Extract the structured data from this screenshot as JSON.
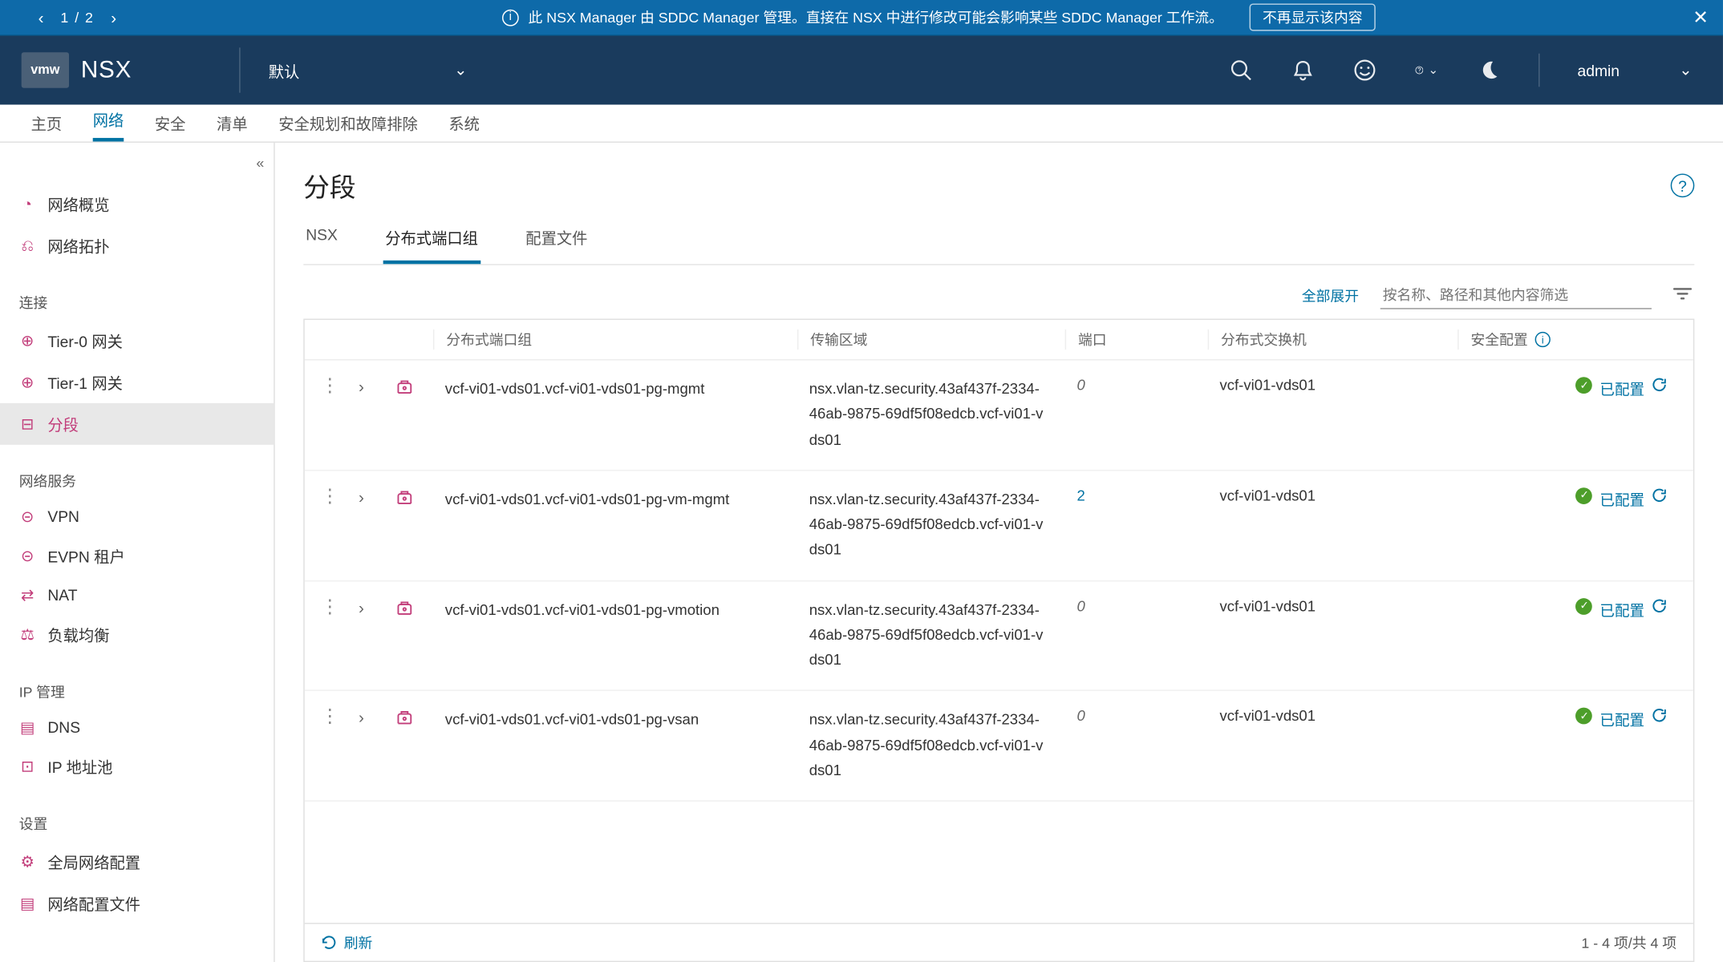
{
  "banner": {
    "pager": "1 / 2",
    "info_glyph": "i",
    "message": "此 NSX Manager 由 SDDC Manager 管理。直接在 NSX 中进行修改可能会影响某些 SDDC Manager 工作流。",
    "dismiss": "不再显示该内容",
    "close_glyph": "✕"
  },
  "header": {
    "logo": "vmw",
    "brand": "NSX",
    "tenant": "默认",
    "user": "admin",
    "chevron_glyph": "⌄",
    "icons": {
      "search": "⌕",
      "bell": "🔔",
      "smiley": "☺",
      "help": "?",
      "dark": "☾"
    }
  },
  "top_tabs": [
    "主页",
    "网络",
    "安全",
    "清单",
    "安全规划和故障排除",
    "系统"
  ],
  "top_tabs_active": 1,
  "sidebar": {
    "collapse_glyph": "«",
    "groups": [
      {
        "label": "",
        "items": [
          {
            "icon": "◔",
            "label": "网络概览",
            "pink": true
          },
          {
            "icon": "⎌",
            "label": "网络拓扑",
            "pink": true
          }
        ]
      },
      {
        "label": "连接",
        "items": [
          {
            "icon": "⊕",
            "label": "Tier-0 网关",
            "pink": true
          },
          {
            "icon": "⊕",
            "label": "Tier-1 网关",
            "pink": true
          },
          {
            "icon": "⊟",
            "label": "分段",
            "pink": true,
            "active": true
          }
        ]
      },
      {
        "label": "网络服务",
        "items": [
          {
            "icon": "⊝",
            "label": "VPN",
            "pink": true
          },
          {
            "icon": "⊝",
            "label": "EVPN 租户",
            "pink": true
          },
          {
            "icon": "⇄",
            "label": "NAT",
            "pink": true
          },
          {
            "icon": "⚖",
            "label": "负载均衡",
            "pink": true
          }
        ]
      },
      {
        "label": "IP 管理",
        "items": [
          {
            "icon": "▤",
            "label": "DNS",
            "pink": true
          },
          {
            "icon": "⊡",
            "label": "IP 地址池",
            "pink": true
          }
        ]
      },
      {
        "label": "设置",
        "items": [
          {
            "icon": "⚙",
            "label": "全局网络配置",
            "pink": true
          },
          {
            "icon": "▤",
            "label": "网络配置文件",
            "pink": true
          }
        ]
      }
    ]
  },
  "page": {
    "title": "分段",
    "help": "?",
    "subtabs": [
      "NSX",
      "分布式端口组",
      "配置文件"
    ],
    "subtabs_active": 1,
    "expand_all": "全部展开",
    "search_placeholder": "按名称、路径和其他内容筛选",
    "columns": {
      "name": "分布式端口组",
      "tz": "传输区域",
      "port": "端口",
      "switch": "分布式交换机",
      "sec": "安全配置"
    },
    "rows": [
      {
        "name": "vcf-vi01-vds01.vcf-vi01-vds01-pg-mgmt",
        "tz": "nsx.vlan-tz.security.43af437f-2334-46ab-9875-69df5f08edcb.vcf-vi01-vds01",
        "port": "0",
        "port_link": false,
        "switch": "vcf-vi01-vds01",
        "sec": "已配置"
      },
      {
        "name": "vcf-vi01-vds01.vcf-vi01-vds01-pg-vm-mgmt",
        "tz": "nsx.vlan-tz.security.43af437f-2334-46ab-9875-69df5f08edcb.vcf-vi01-vds01",
        "port": "2",
        "port_link": true,
        "switch": "vcf-vi01-vds01",
        "sec": "已配置"
      },
      {
        "name": "vcf-vi01-vds01.vcf-vi01-vds01-pg-vmotion",
        "tz": "nsx.vlan-tz.security.43af437f-2334-46ab-9875-69df5f08edcb.vcf-vi01-vds01",
        "port": "0",
        "port_link": false,
        "switch": "vcf-vi01-vds01",
        "sec": "已配置"
      },
      {
        "name": "vcf-vi01-vds01.vcf-vi01-vds01-pg-vsan",
        "tz": "nsx.vlan-tz.security.43af437f-2334-46ab-9875-69df5f08edcb.vcf-vi01-vds01",
        "port": "0",
        "port_link": false,
        "switch": "vcf-vi01-vds01",
        "sec": "已配置"
      }
    ],
    "footer": {
      "refresh": "刷新",
      "count": "1 - 4 项/共 4 项"
    }
  }
}
